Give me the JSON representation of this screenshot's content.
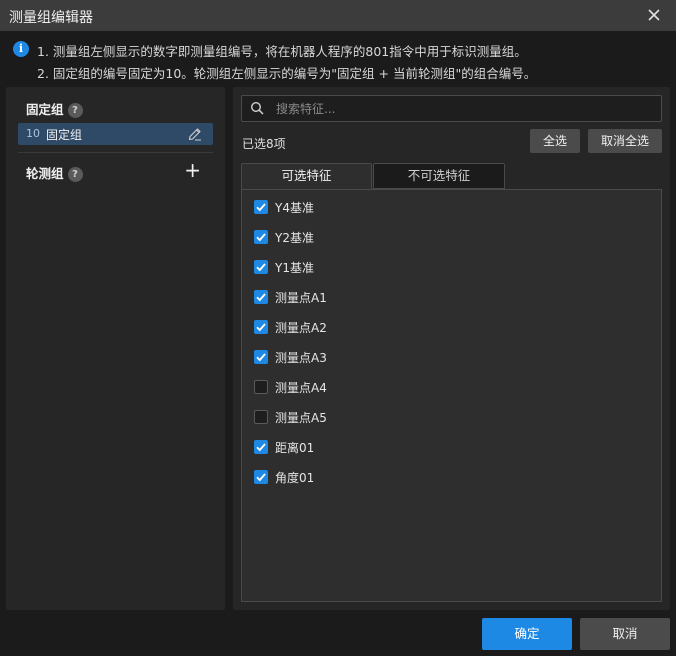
{
  "window": {
    "title": "测量组编辑器",
    "close_icon": "close-icon"
  },
  "info": {
    "icon": "info-icon",
    "line1": "1. 测量组左侧显示的数字即测量组编号，将在机器人程序的801指令中用于标识测量组。",
    "line2": "2. 固定组的编号固定为10。轮测组左侧显示的编号为\"固定组 + 当前轮测组\"的组合编号。"
  },
  "left_panel": {
    "fixed_group": {
      "header": "固定组",
      "help": "?",
      "item": {
        "number": "10",
        "name": "固定组",
        "icon": "edit-icon"
      }
    },
    "rotation_group": {
      "header": "轮测组",
      "help": "?",
      "add_label": "+"
    }
  },
  "right_panel": {
    "search": {
      "placeholder": "搜索特征...",
      "value": ""
    },
    "selected_count": "已选8项",
    "select_all": "全选",
    "deselect_all": "取消全选",
    "tabs": [
      {
        "label": "可选特征",
        "active": true
      },
      {
        "label": "不可选特征",
        "active": false
      }
    ],
    "features": [
      {
        "label": "Y4基准",
        "checked": true
      },
      {
        "label": "Y2基准",
        "checked": true
      },
      {
        "label": "Y1基准",
        "checked": true
      },
      {
        "label": "测量点A1",
        "checked": true
      },
      {
        "label": "测量点A2",
        "checked": true
      },
      {
        "label": "测量点A3",
        "checked": true
      },
      {
        "label": "测量点A4",
        "checked": false
      },
      {
        "label": "测量点A5",
        "checked": false
      },
      {
        "label": "距离01",
        "checked": true
      },
      {
        "label": "角度01",
        "checked": true
      }
    ]
  },
  "footer": {
    "ok": "确定",
    "cancel": "取消"
  },
  "colors": {
    "accent": "#1e88e5",
    "selected_item": "#2f4a66",
    "button": "#4b4b4b",
    "background": "#1b1b1b",
    "panel": "#262626"
  }
}
